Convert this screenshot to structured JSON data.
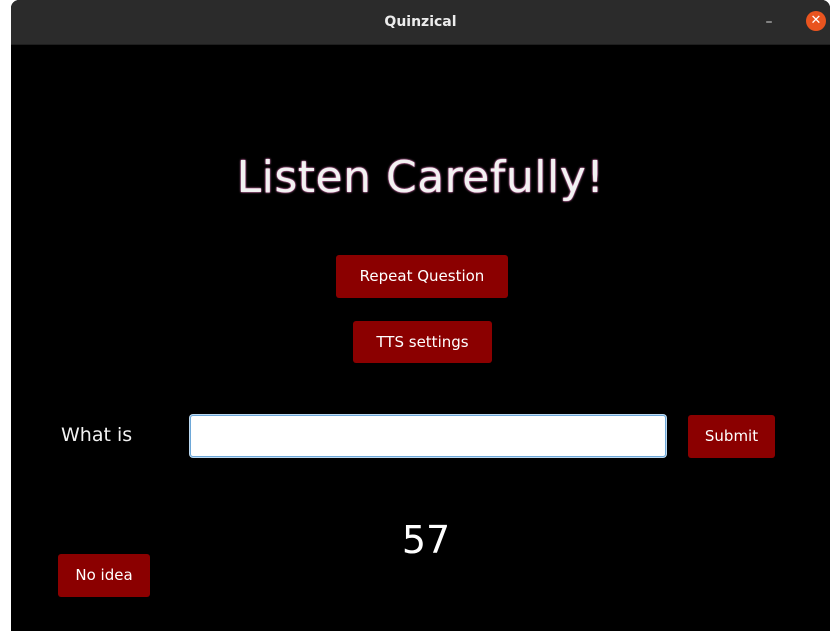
{
  "window": {
    "title": "Quinzical",
    "minimize_symbol": "–",
    "close_symbol": "✕"
  },
  "main": {
    "heading": "Listen Carefully!",
    "repeat_label": "Repeat Question",
    "tts_label": "TTS settings",
    "prompt_label": "What is",
    "answer_value": "",
    "answer_placeholder": "",
    "submit_label": "Submit",
    "no_idea_label": "No idea",
    "timer_value": "57"
  },
  "colors": {
    "background": "#000000",
    "button": "#8b0000",
    "titlebar": "#2b2b2b",
    "close": "#e9541f"
  }
}
